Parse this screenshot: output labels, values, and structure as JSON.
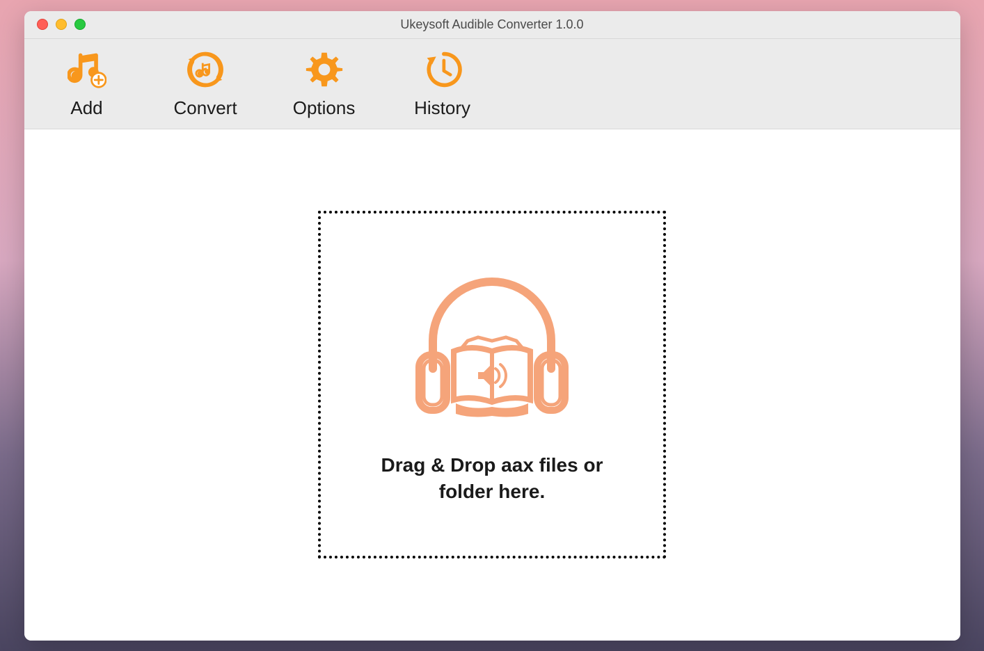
{
  "titlebar": {
    "title": "Ukeysoft Audible Converter 1.0.0"
  },
  "toolbar": {
    "add_label": "Add",
    "convert_label": "Convert",
    "options_label": "Options",
    "history_label": "History"
  },
  "dropzone": {
    "message": "Drag & Drop aax files or folder here."
  },
  "colors": {
    "accent": "#f8971c",
    "illustration": "#f5a47a"
  }
}
